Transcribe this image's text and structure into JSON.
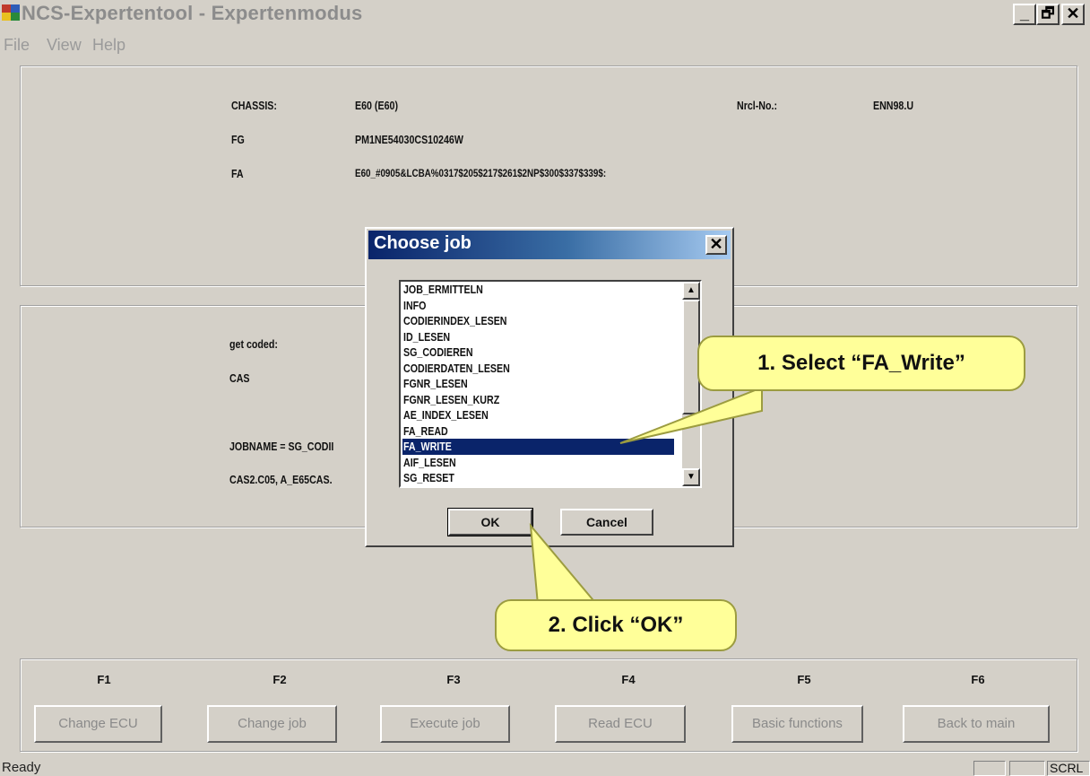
{
  "window": {
    "title": "NCS-Expertentool - Expertenmodus",
    "minimize_glyph": "_",
    "restore_glyph": "🗗",
    "close_glyph": "✕"
  },
  "menu": [
    "File",
    "View",
    "Help"
  ],
  "vehicle_info": {
    "chassis_label": "CHASSIS:",
    "chassis_value": "E60 (E60)",
    "nrcl_label": "Nrcl-No.:",
    "nrcl_value": "ENN98.U",
    "fg_label": "FG",
    "fg_value": "PM1NE54030CS10246W",
    "fa_label": "FA",
    "fa_value": "E60_#0905&LCBA%0317$205$217$261$2NP$300$337$339$:"
  },
  "job_info": {
    "get_coded_label": "get coded:",
    "ecu": "CAS",
    "jobname": "JOBNAME = SG_CODII",
    "file": "CAS2.C05, A_E65CAS."
  },
  "dialog": {
    "title": "Choose job",
    "close_glyph": "✕",
    "jobs": [
      "JOB_ERMITTELN",
      "INFO",
      "CODIERINDEX_LESEN",
      "ID_LESEN",
      "SG_CODIEREN",
      "CODIERDATEN_LESEN",
      "FGNR_LESEN",
      "FGNR_LESEN_KURZ",
      "AE_INDEX_LESEN",
      "FA_READ",
      "FA_WRITE",
      "AIF_LESEN",
      "SG_RESET"
    ],
    "selected": "FA_WRITE",
    "ok_label": "OK",
    "cancel_label": "Cancel"
  },
  "function_keys": [
    {
      "key": "F1",
      "label": "Change ECU"
    },
    {
      "key": "F2",
      "label": "Change job"
    },
    {
      "key": "F3",
      "label": "Execute job"
    },
    {
      "key": "F4",
      "label": "Read ECU"
    },
    {
      "key": "F5",
      "label": "Basic functions"
    },
    {
      "key": "F6",
      "label": "Back to main"
    }
  ],
  "status": {
    "text": "Ready",
    "scrl": "SCRL"
  },
  "callouts": {
    "step1": "1. Select “FA_Write”",
    "step2": "2. Click “OK”"
  },
  "colors": {
    "window_bg": "#d4d0c8",
    "dialog_title": "#0a246a",
    "selection": "#0a246a",
    "callout": "#ffff99"
  }
}
